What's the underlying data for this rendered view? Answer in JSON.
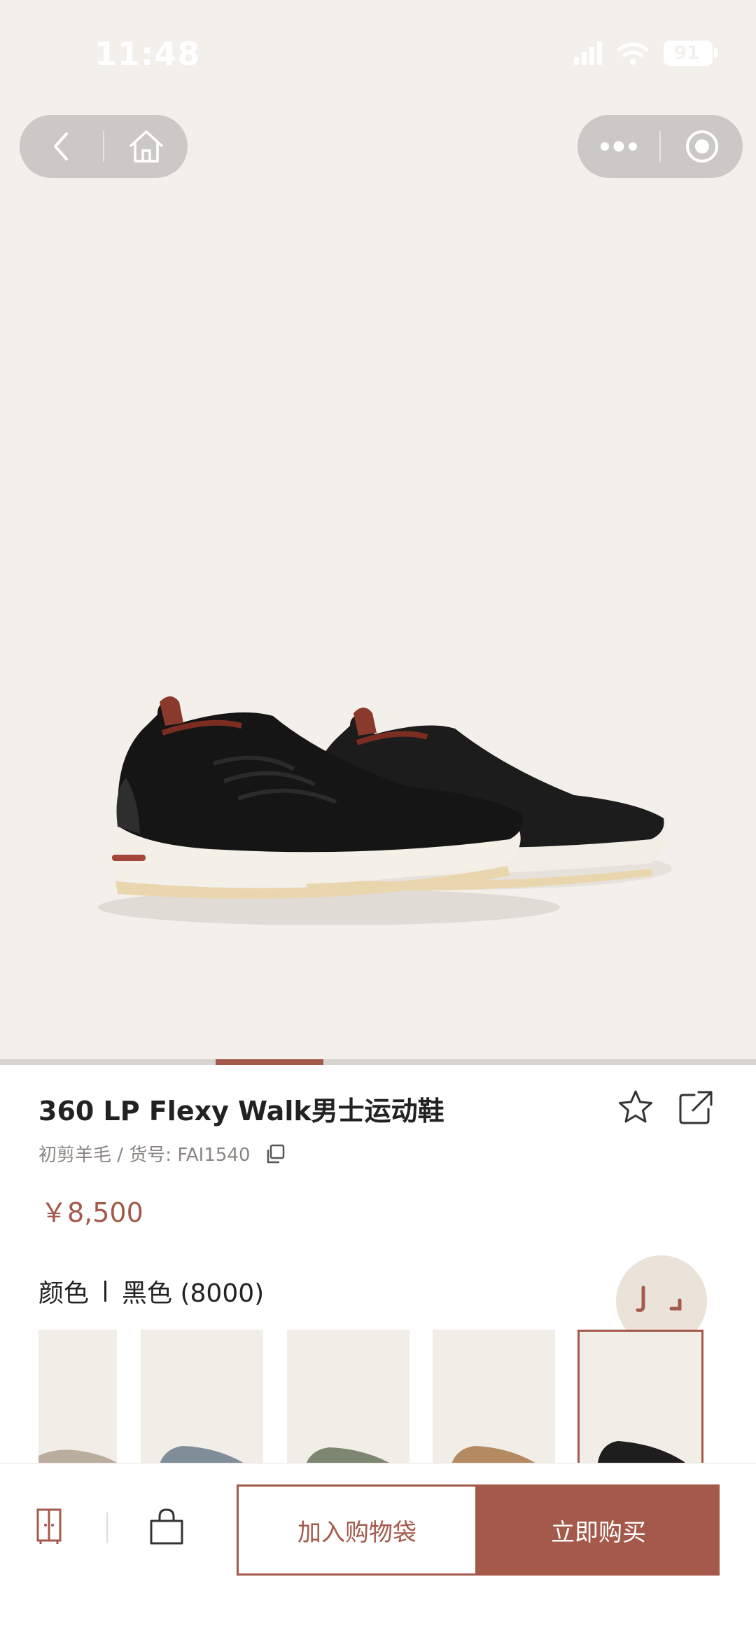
{
  "status_bar": {
    "time": "11:48",
    "battery": "91"
  },
  "nav": {
    "back_icon": "chevron-left-icon",
    "home_icon": "home-icon",
    "more_icon": "more-dots-icon",
    "close_icon": "target-circle-icon"
  },
  "gallery": {
    "current_index": 3,
    "total": 10
  },
  "product": {
    "title": "360 LP Flexy Walk男士运动鞋",
    "meta": "初剪羊毛 / 货号:  FAI1540",
    "price": "￥8,500",
    "color_label": "颜色",
    "color_value": "黑色 (8000)"
  },
  "swatches": [
    {
      "name": "taupe",
      "color": "#b9ad9e",
      "selected": false
    },
    {
      "name": "blue-grey",
      "color": "#7f8e98",
      "selected": false
    },
    {
      "name": "olive",
      "color": "#7c8670",
      "selected": false
    },
    {
      "name": "tan",
      "color": "#b48a62",
      "selected": false
    },
    {
      "name": "black",
      "color": "#1e1e1e",
      "selected": true
    }
  ],
  "actions": {
    "add_to_bag": "加入购物袋",
    "buy_now": "立即购买"
  },
  "colors": {
    "accent": "#a4594a",
    "hero_bg": "#f3f0eb"
  }
}
